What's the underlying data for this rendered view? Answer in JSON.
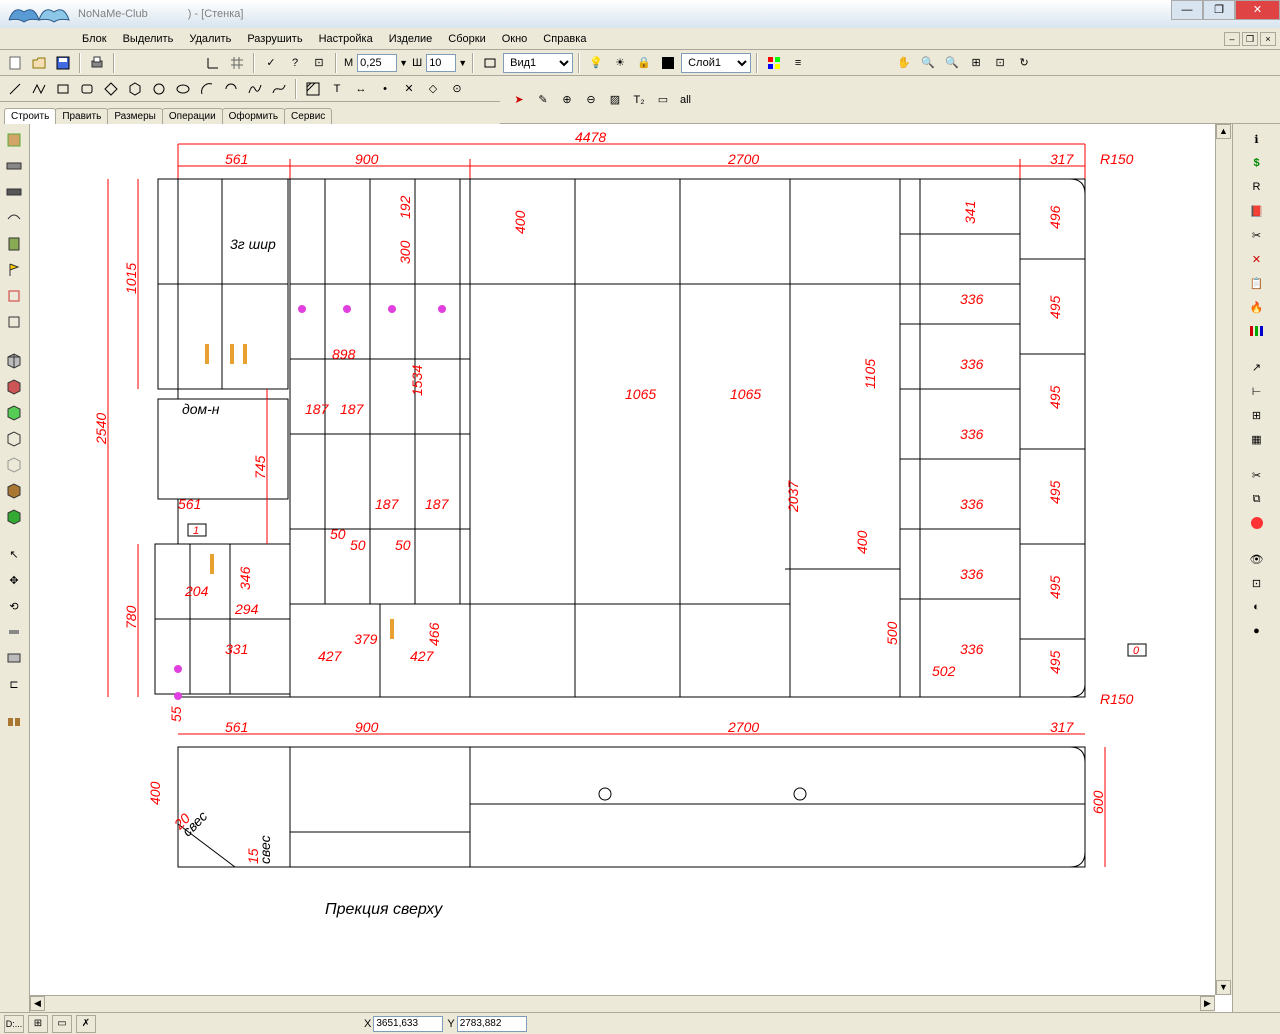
{
  "title": {
    "app": "NoNaMe-Club",
    "doc": ") - [Стенка]"
  },
  "menu": [
    "Блок",
    "Выделить",
    "Удалить",
    "Разрушить",
    "Настройка",
    "Изделие",
    "Сборки",
    "Окно",
    "Справка"
  ],
  "toolbar": {
    "m_label": "М",
    "m_value": "0,25",
    "w_label": "Ш",
    "w_value": "10",
    "view": "Вид1",
    "layer": "Слой1"
  },
  "tabs": [
    "Строить",
    "Править",
    "Размеры",
    "Операции",
    "Оформить",
    "Сервис"
  ],
  "rightbar_all": "all",
  "drawing": {
    "top_total": "4478",
    "top_widths": [
      "561",
      "900",
      "2700",
      "317"
    ],
    "r150_top": "R150",
    "r150_bot": "R150",
    "left_2540": "2540",
    "left_1015": "1015",
    "left_745": "745",
    "left_780": "780",
    "left_55": "55",
    "dims": {
      "d192": "192",
      "d300": "300",
      "d400": "400",
      "d341": "341",
      "d496": "496",
      "d336a": "336",
      "d495a": "495",
      "d336b": "336",
      "d495b": "495",
      "d336c": "336",
      "d495c": "495",
      "d336d": "336",
      "d495d": "495",
      "d336e": "336",
      "d495e": "495",
      "d336f": "336",
      "d898": "898",
      "d1534": "1534",
      "d187a": "187",
      "d187b": "187",
      "d187c": "187",
      "d187d": "187",
      "d50a": "50",
      "d50b": "50",
      "d50c": "50",
      "d561": "561",
      "d1065a": "1065",
      "d1065b": "1065",
      "d1105": "1105",
      "d2037": "2037",
      "d400b": "400",
      "d500": "500",
      "d502": "502",
      "d204": "204",
      "d294": "294",
      "d346": "346",
      "d331": "331",
      "d427a": "427",
      "d379": "379",
      "d427b": "427",
      "d466": "466",
      "d1": "1",
      "d0": "0"
    },
    "text_domin": "дом-н",
    "text_shup": "3г шир",
    "bottom_widths": [
      "561",
      "900",
      "2700",
      "317"
    ],
    "bottom_400": "400",
    "bottom_600": "600",
    "bottom_20": "20",
    "bottom_15": "15",
    "bottom_sves1": "свес",
    "bottom_sves2": "свес",
    "caption": "Прекция сверху"
  },
  "status": {
    "x_label": "X",
    "x_value": "3651,633",
    "y_label": "Y",
    "y_value": "2783,882",
    "d_label": "D:..."
  }
}
